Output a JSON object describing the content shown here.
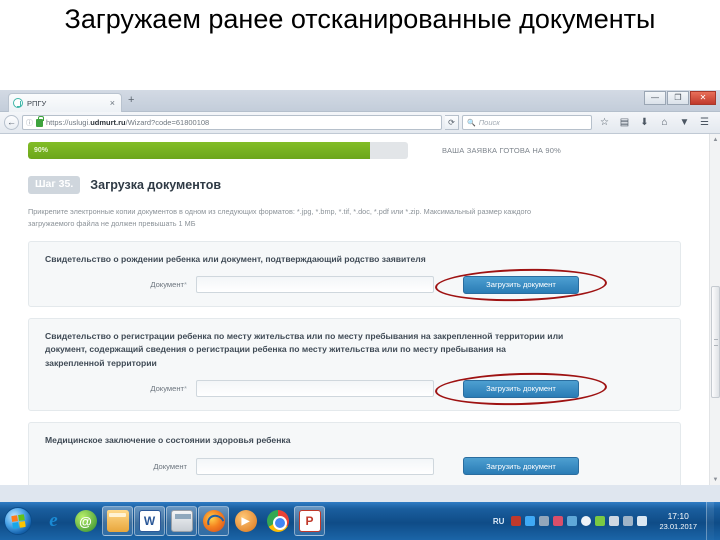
{
  "slide": {
    "title": "Загружаем ранее отсканированные документы"
  },
  "browser": {
    "tab": {
      "label": "РПГУ",
      "close": "×",
      "favicon": "rpgu-logo-icon"
    },
    "new_tab": "+",
    "window_controls": {
      "minimize": "—",
      "maximize": "❐",
      "close": "✕"
    },
    "nav": {
      "back": "←",
      "info": "ⓘ",
      "url": "https://uslugi.udmurt.ru/Wizard?code=61800108",
      "url_host_bold": "udmurt.ru",
      "url_prefix": "https://uslugi.",
      "url_suffix": "/Wizard?code=61800108",
      "reload": "⟳"
    },
    "search": {
      "placeholder": "Поиск",
      "icon": "search-icon"
    },
    "toolbar_icons": [
      "star-icon",
      "library-icon",
      "download-icon",
      "home-icon",
      "pocket-icon",
      "menu-icon"
    ]
  },
  "page": {
    "progress": {
      "percent_label": "90%",
      "value": 90,
      "note": "ВАША ЗАЯВКА ГОТОВА НА 90%"
    },
    "step": {
      "badge": "Шаг 35.",
      "title": "Загрузка документов"
    },
    "hint": "Прикрепите электронные копии документов в одном из следующих форматов: *.jpg, *.bmp, *.tif, *.doc, *.pdf или *.zip. Максимальный размер каждого загружаемого файла не должен превышать 1 МБ",
    "documents": [
      {
        "title": "Свидетельство о рождении ребенка или документ, подтверждающий родство заявителя",
        "field_label": "Документ",
        "required": "*",
        "value": "",
        "button": "Загрузить документ",
        "highlighted": true
      },
      {
        "title": "Свидетельство о регистрации ребенка по месту жительства или по месту пребывания на закрепленной территории или документ, содержащий сведения о регистрации ребенка по месту жительства или по месту пребывания на закрепленной территории",
        "field_label": "Документ",
        "required": "*",
        "value": "",
        "button": "Загрузить документ",
        "highlighted": true
      },
      {
        "title": "Медицинское заключение о состоянии здоровья ребенка",
        "field_label": "Документ",
        "required": "",
        "value": "",
        "button": "Загрузить документ",
        "highlighted": false
      }
    ],
    "scrollbar": {
      "up": "▲",
      "down": "▼"
    }
  },
  "taskbar": {
    "start": "start-orb",
    "items": [
      {
        "name": "internet-explorer",
        "glyph": "e",
        "cls": "ico-ie",
        "active": false
      },
      {
        "name": "mail-agent",
        "glyph": "@",
        "cls": "ico-at",
        "active": false
      },
      {
        "name": "file-explorer",
        "glyph": "",
        "cls": "ico-folder",
        "active": true
      },
      {
        "name": "microsoft-word",
        "glyph": "W",
        "cls": "ico-word",
        "active": true
      },
      {
        "name": "calculator",
        "glyph": "",
        "cls": "ico-calc",
        "active": true
      },
      {
        "name": "mozilla-firefox",
        "glyph": "",
        "cls": "ico-fx",
        "active": true
      },
      {
        "name": "media-player",
        "glyph": "▶",
        "cls": "ico-media",
        "active": false
      },
      {
        "name": "google-chrome",
        "glyph": "",
        "cls": "ico-chrome",
        "active": false
      },
      {
        "name": "powerpoint",
        "glyph": "P",
        "cls": "ico-ppt",
        "active": true
      }
    ],
    "tray": {
      "language": "RU",
      "icons": [
        "notification-icon",
        "screen-icon",
        "usb-icon",
        "antivirus-icon",
        "network-sync-icon",
        "info-icon",
        "shield-icon",
        "flag-icon",
        "settings-icon",
        "volume-icon"
      ],
      "time": "17:10",
      "date": "23.01.2017"
    }
  },
  "colors": {
    "progress_green": "#6ca61b",
    "button_blue": "#2a7cb5",
    "highlight_red": "#9e1212",
    "taskbar_blue": "#0f4c87"
  }
}
